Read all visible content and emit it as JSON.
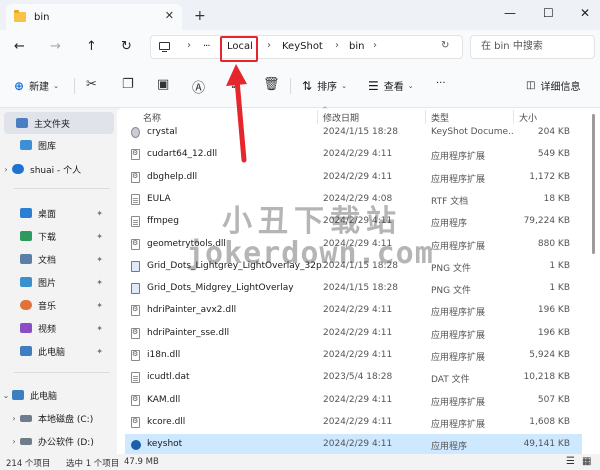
{
  "window": {
    "tab_title": "bin",
    "tab_close": "✕",
    "new_tab": "+",
    "minimize": "—",
    "maximize": "☐",
    "close": "✕"
  },
  "nav": {
    "back": "←",
    "forward": "→",
    "up": "↑",
    "refresh": "↻",
    "ellipsis": "···"
  },
  "address": {
    "crumbs": [
      "Local",
      "KeyShot",
      "bin"
    ],
    "sep": "›",
    "search_placeholder": "在 bin 中搜索"
  },
  "toolbar": {
    "new_label": "新建",
    "sort_label": "排序",
    "view_label": "查看",
    "more": "···",
    "details_label": "详细信息"
  },
  "sidebar": {
    "items": [
      {
        "label": "主文件夹",
        "icon": "home-icon"
      },
      {
        "label": "图库",
        "icon": "gallery-icon"
      },
      {
        "label": "shuai - 个人",
        "icon": "onedrive-icon"
      },
      {
        "label": "桌面",
        "icon": "desktop-icon"
      },
      {
        "label": "下载",
        "icon": "download-icon"
      },
      {
        "label": "文档",
        "icon": "documents-icon"
      },
      {
        "label": "图片",
        "icon": "pictures-icon"
      },
      {
        "label": "音乐",
        "icon": "music-icon"
      },
      {
        "label": "视频",
        "icon": "video-icon"
      },
      {
        "label": "此电脑",
        "icon": "pc-icon"
      },
      {
        "label": "此电脑",
        "icon": "pc-icon"
      },
      {
        "label": "本地磁盘 (C:)",
        "icon": "drive-icon"
      },
      {
        "label": "办公软件 (D:)",
        "icon": "drive-icon"
      }
    ],
    "pin": "📌",
    "expand": "›",
    "collapse": "⌄"
  },
  "columns": {
    "name": "名称",
    "date": "修改日期",
    "type": "类型",
    "size": "大小",
    "sort_indicator": "^"
  },
  "files": [
    {
      "name": "crystal",
      "date": "2024/1/15 18:28",
      "type": "KeyShot Docume...",
      "size": "204 KB",
      "icon": "cry"
    },
    {
      "name": "cudart64_12.dll",
      "date": "2024/2/29 4:11",
      "type": "应用程序扩展",
      "size": "549 KB",
      "icon": "dll"
    },
    {
      "name": "dbghelp.dll",
      "date": "2024/2/29 4:11",
      "type": "应用程序扩展",
      "size": "1,172 KB",
      "icon": "dll"
    },
    {
      "name": "EULA",
      "date": "2024/2/29 4:08",
      "type": "RTF 文档",
      "size": "18 KB",
      "icon": "doc"
    },
    {
      "name": "ffmpeg",
      "date": "2024/2/29 4:11",
      "type": "应用程序",
      "size": "79,224 KB",
      "icon": "doc"
    },
    {
      "name": "geometrytools.dll",
      "date": "2024/2/29 4:11",
      "type": "应用程序扩展",
      "size": "880 KB",
      "icon": "dll"
    },
    {
      "name": "Grid_Dots_Lightgrey_LightOverlay_32p...",
      "date": "2024/1/15 18:28",
      "type": "PNG 文件",
      "size": "1 KB",
      "icon": "img"
    },
    {
      "name": "Grid_Dots_Midgrey_LightOverlay",
      "date": "2024/1/15 18:28",
      "type": "PNG 文件",
      "size": "1 KB",
      "icon": "img"
    },
    {
      "name": "hdriPainter_avx2.dll",
      "date": "2024/2/29 4:11",
      "type": "应用程序扩展",
      "size": "196 KB",
      "icon": "dll"
    },
    {
      "name": "hdriPainter_sse.dll",
      "date": "2024/2/29 4:11",
      "type": "应用程序扩展",
      "size": "196 KB",
      "icon": "dll"
    },
    {
      "name": "i18n.dll",
      "date": "2024/2/29 4:11",
      "type": "应用程序扩展",
      "size": "5,924 KB",
      "icon": "dll"
    },
    {
      "name": "icudtl.dat",
      "date": "2023/5/4 18:28",
      "type": "DAT 文件",
      "size": "10,218 KB",
      "icon": "doc"
    },
    {
      "name": "KAM.dll",
      "date": "2024/2/29 4:11",
      "type": "应用程序扩展",
      "size": "507 KB",
      "icon": "dll"
    },
    {
      "name": "kcore.dll",
      "date": "2024/2/29 4:11",
      "type": "应用程序扩展",
      "size": "1,608 KB",
      "icon": "dll"
    },
    {
      "name": "keyshot",
      "date": "2024/2/29 4:11",
      "type": "应用程序",
      "size": "49,141 KB",
      "icon": "app"
    }
  ],
  "status": {
    "count": "214 个项目",
    "selected": "选中 1 个项目",
    "selected_size": "47.9 MB"
  },
  "watermark": {
    "line1": "小丑下载站",
    "line2": "jokerdown.com"
  },
  "colors": {
    "accent": "#1a6fd8",
    "highlight_box": "#e5262c",
    "selected_row": "#cde8ff",
    "folder": "#f6c343"
  }
}
